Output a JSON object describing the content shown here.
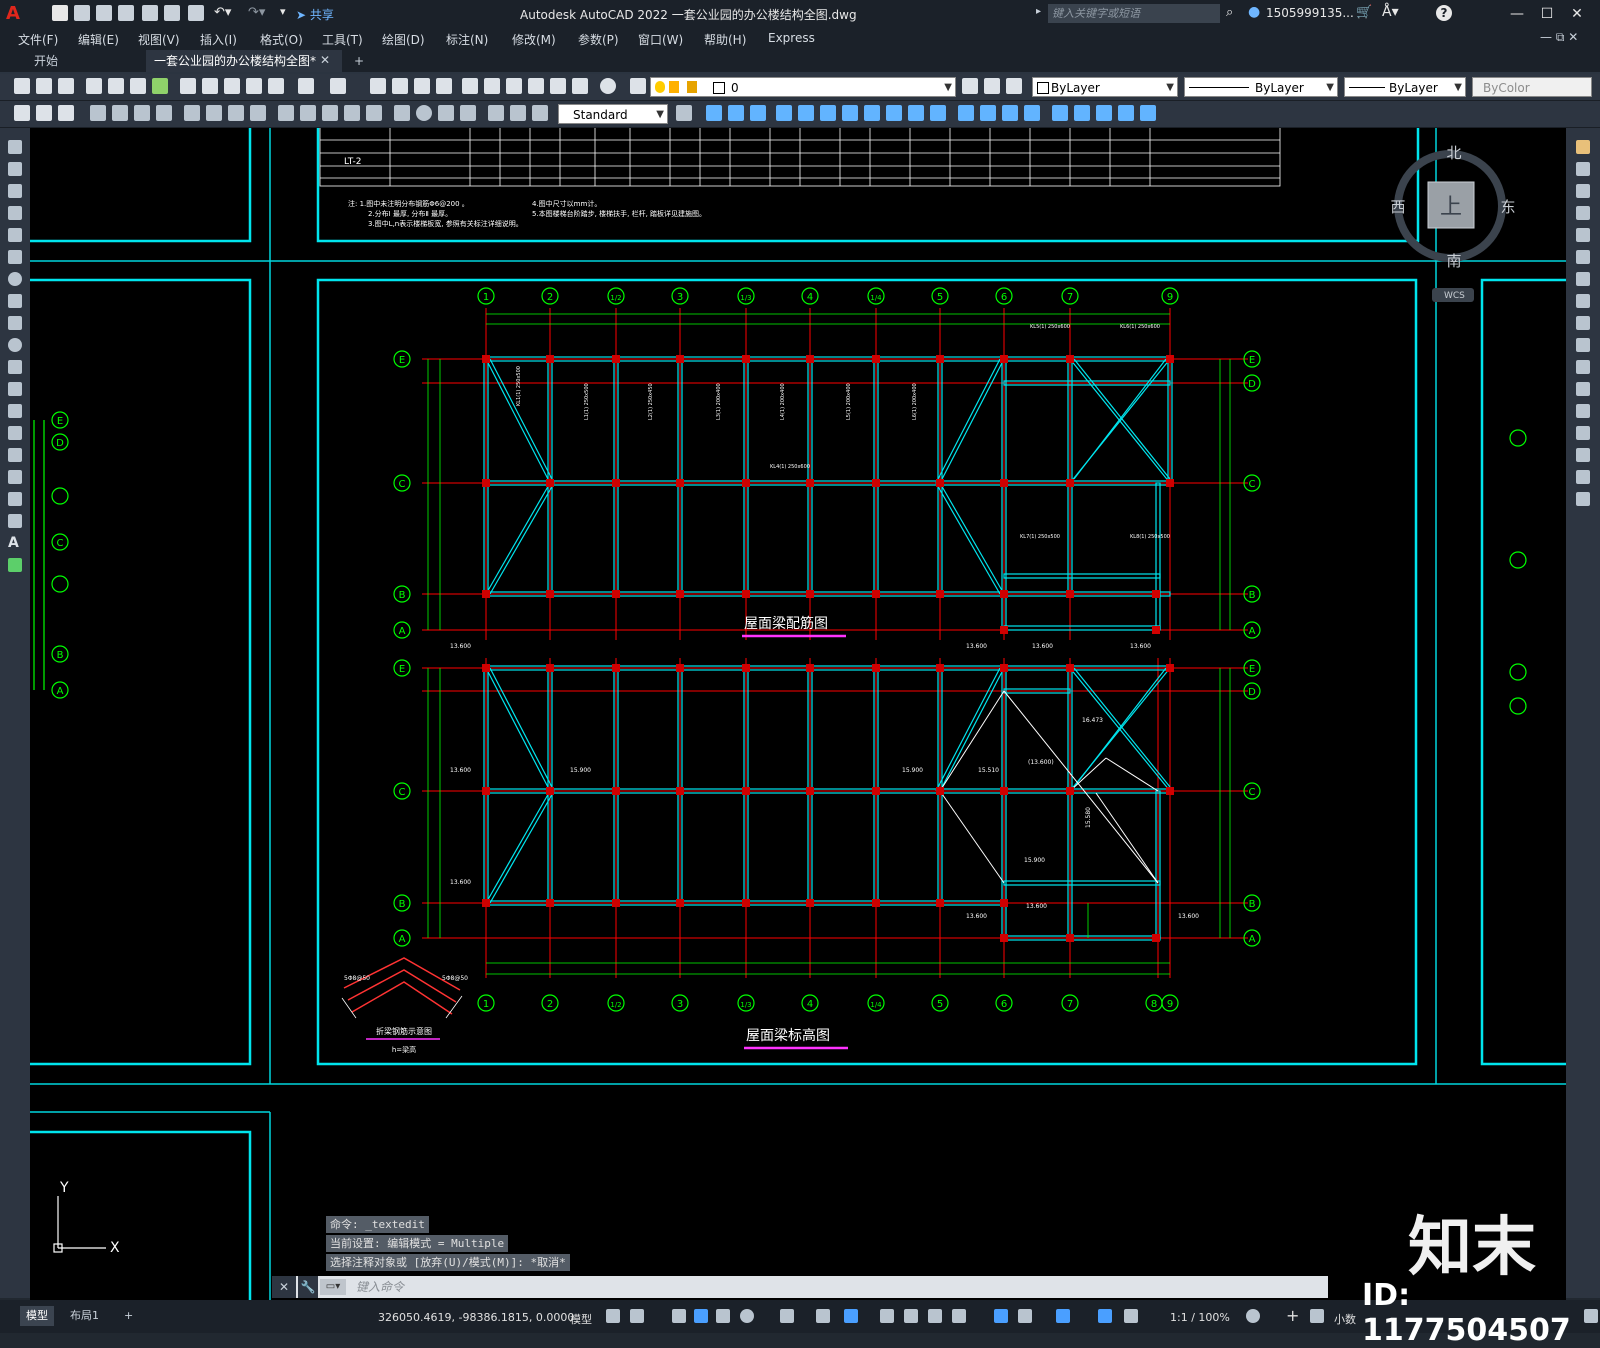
{
  "app": {
    "logo": "A",
    "title": "Autodesk AutoCAD 2022    一套公业园的办公楼结构全图.dwg",
    "share": "共享",
    "search_placeholder": "键入关键字或短语",
    "user": "1505999135...",
    "help": "?"
  },
  "menu": [
    "文件(F)",
    "编辑(E)",
    "视图(V)",
    "插入(I)",
    "格式(O)",
    "工具(T)",
    "绘图(D)",
    "标注(N)",
    "修改(M)",
    "参数(P)",
    "窗口(W)",
    "帮助(H)",
    "Express"
  ],
  "tabs": [
    {
      "label": "开始",
      "active": false
    },
    {
      "label": "一套公业园的办公楼结构全图*",
      "active": true
    },
    {
      "label": "+",
      "active": false
    }
  ],
  "toolbar1": {
    "layer_value": "0",
    "color": "ByLayer",
    "linetype": "ByLayer",
    "lineweight": "ByLayer",
    "plotstyle": "ByColor"
  },
  "toolbar2": {
    "textstyle": "Standard"
  },
  "viewcube": {
    "north": "北",
    "south": "南",
    "east": "东",
    "west": "西",
    "top": "上",
    "wcs": "WCS"
  },
  "drawing": {
    "table_label": "LT-2",
    "notes": [
      "注: 1.图中未注明分布钢筋Φ6@200 。",
      "2.分布Ⅰ 最厚, 分布Ⅱ 最厚。",
      "3.图中L,n表示楼梯板宽, 参照有关标注详细说明。",
      "4.图中尺寸以mm计。",
      "5.本图楼梯台阶踏步, 楼梯扶手, 栏杆, 踏板详见建施图。"
    ],
    "plan1_title": "屋面梁配筋图",
    "plan2_title": "屋面梁标高图",
    "detail_title": "折梁钢筋示意图",
    "detail_sub": "h=梁高",
    "axes_top": [
      "1",
      "2",
      "1/2",
      "3",
      "1/3",
      "4",
      "1/4",
      "5",
      "6",
      "7",
      "9"
    ],
    "axes_bottom": [
      "1",
      "2",
      "1/2",
      "3",
      "1/3",
      "4",
      "1/4",
      "5",
      "6",
      "7",
      "8",
      "9"
    ],
    "axes_rows": [
      "E",
      "D",
      "C",
      "B",
      "A"
    ],
    "elev_labels": [
      "13.600",
      "15.900",
      "15.510",
      "(13.600)",
      "16.473",
      "15.580"
    ]
  },
  "command": {
    "history": [
      "命令: _textedit",
      "当前设置: 编辑模式 = Multiple",
      "选择注释对象或 [放弃(U)/模式(M)]: *取消*"
    ],
    "placeholder": "键入命令"
  },
  "status": {
    "layout_tabs": [
      "模型",
      "布局1",
      "+"
    ],
    "coords": "326050.4619, -98386.1815, 0.0000",
    "model": "模型",
    "scale": "1:1 / 100%",
    "units": "小数"
  },
  "watermark": {
    "logo": "知末",
    "id": "ID: 1177504507"
  },
  "colors": {
    "cyan": "#00e5ee",
    "red": "#ff0000",
    "green": "#00ff00",
    "magenta": "#ff33ff",
    "white": "#ffffff"
  }
}
